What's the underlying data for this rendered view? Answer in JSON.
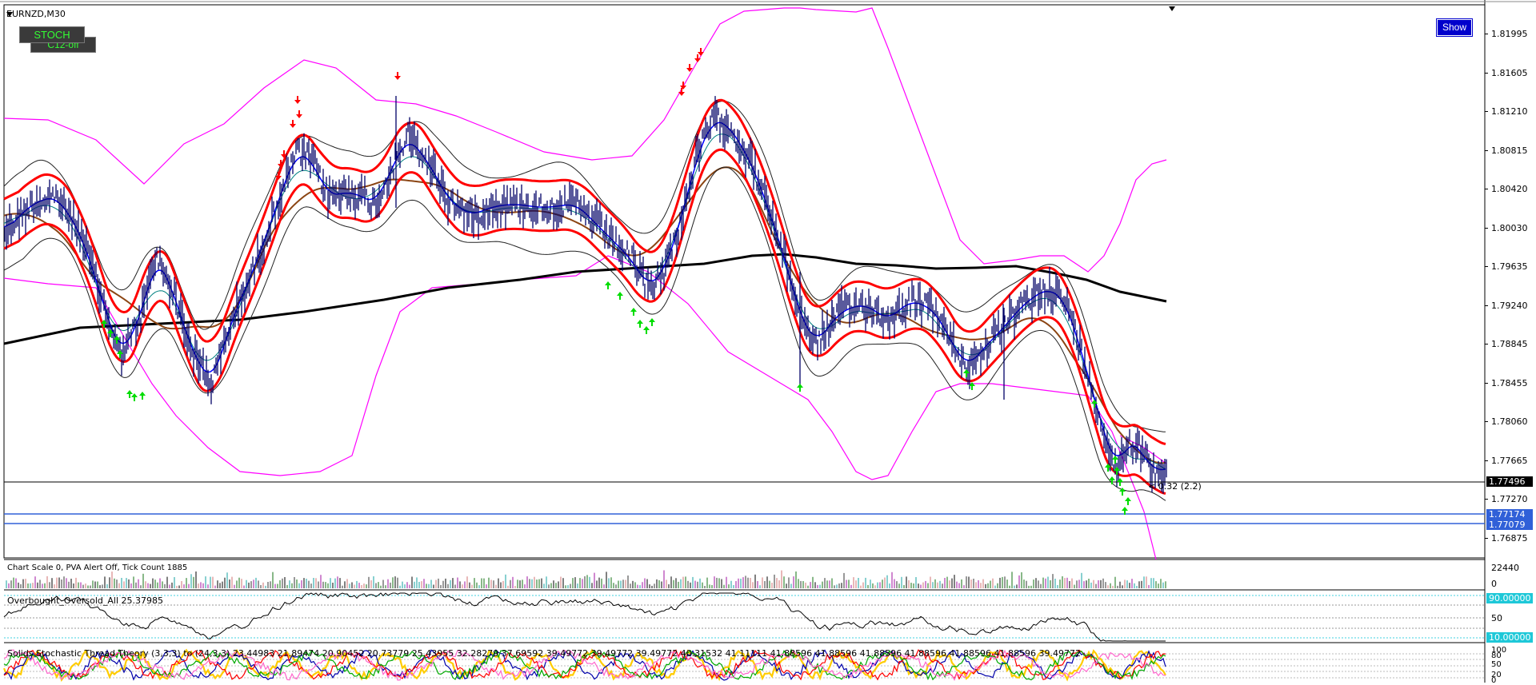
{
  "chart": {
    "symbol_timeframe": "EURNZD,M30"
  },
  "buttons": {
    "stoch": "STOCH",
    "c12": "C12-off",
    "show": "Show"
  },
  "price_axis": {
    "labels": [
      "1.81995",
      "1.81605",
      "1.81210",
      "1.80815",
      "1.80420",
      "1.80030",
      "1.79635",
      "1.79240",
      "1.78845",
      "1.78455",
      "1.78060",
      "1.77665",
      "1.77270",
      "1.76875"
    ],
    "current_price": "1.77496",
    "line_prices": [
      "1.77174",
      "1.77079"
    ]
  },
  "annotation": {
    "text": "< 0.32 (2.2)"
  },
  "volume_panel": {
    "label": "Chart Scale  0,   PVA Alert Off,   Tick Count  1885",
    "axis_max": "22440",
    "axis_min": "0"
  },
  "oscillator_panel": {
    "label": "Overbought_Oversold_All 25.37985",
    "level_high": "90.00000",
    "level_mid": "50",
    "level_low": "10.00000"
  },
  "stoch_panel": {
    "label": "Solids Stochastic Thread Theory (3,3,3) to (24,3,3) 23.44983 21.89474 20.90452 20.73779 25.43955 32.28279 37.69592 39.49772 39.49772 39.49772 40.31532 41.11111 41.88596 41.88596 41.88596 41.88596 41.88596 41.88596 39.49772",
    "axis_labels": [
      "100",
      "80",
      "50",
      "20",
      "0"
    ]
  },
  "colors": {
    "candles": "#000066",
    "envelope_red": "#ff0000",
    "bands_magenta": "#ff00ff",
    "ma_black": "#000000",
    "ma_brown": "#8b4513",
    "ma_blue": "#0000ff",
    "ma_teal": "#008080",
    "arrow_up": "#00dd00",
    "arrow_down": "#ff0000"
  }
}
